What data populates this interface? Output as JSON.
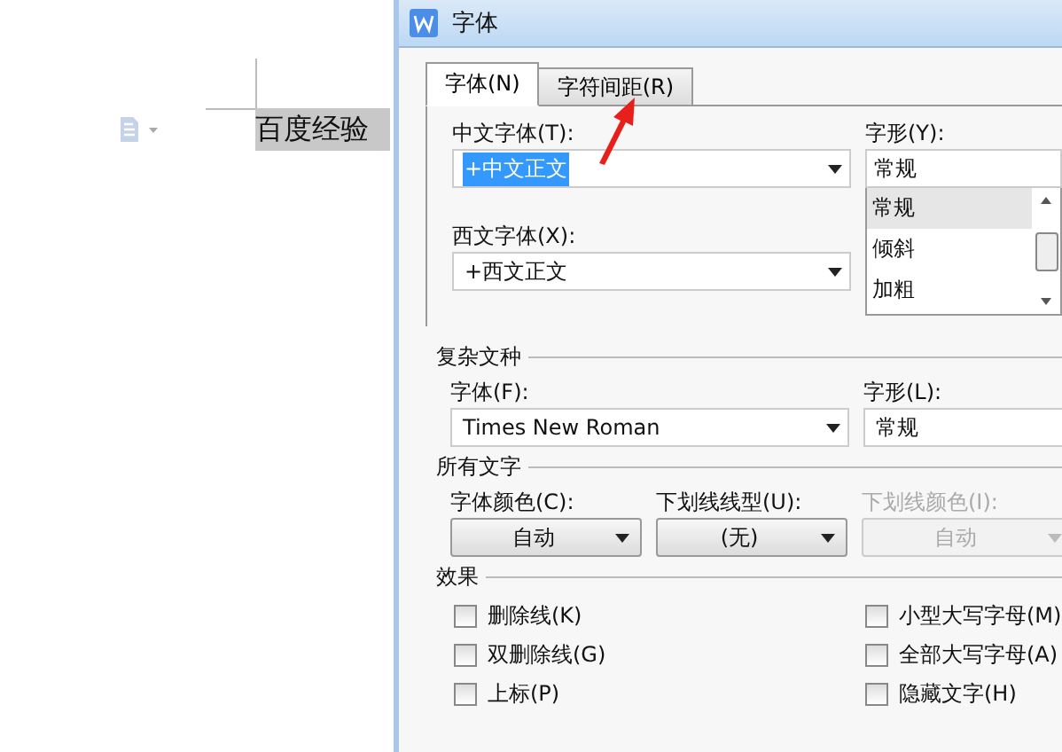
{
  "document": {
    "text": "百度经验",
    "highlighted": true
  },
  "dialog": {
    "title": "字体",
    "tabs": [
      {
        "label": "字体(N)",
        "selected": true
      },
      {
        "label": "字符间距(R)",
        "selected": false
      }
    ],
    "chinese_font": {
      "label": "中文字体(T):",
      "value": "+中文正文",
      "text_selected": true
    },
    "style": {
      "label": "字形(Y):",
      "value": "常规",
      "options": [
        {
          "label": "常规",
          "selected": true
        },
        {
          "label": "倾斜",
          "selected": false
        },
        {
          "label": "加粗",
          "selected": false
        }
      ]
    },
    "western_font": {
      "label": "西文字体(X):",
      "value": "+西文正文",
      "text_selected": false
    },
    "complex_script": {
      "heading": "复杂文种",
      "font": {
        "label": "字体(F):",
        "value": "Times New Roman"
      },
      "style": {
        "label": "字形(L):",
        "value": "常规"
      }
    },
    "all_text": {
      "heading": "所有文字",
      "controls": [
        {
          "label": "字体颜色(C):",
          "value": "自动",
          "disabled": false
        },
        {
          "label": "下划线线型(U):",
          "value": "(无)",
          "disabled": false
        },
        {
          "label": "下划线颜色(I):",
          "value": "自动",
          "disabled": true
        }
      ]
    },
    "effects": {
      "heading": "效果",
      "options": [
        {
          "label": "删除线(K)",
          "checked": false
        },
        {
          "label": "小型大写字母(M)",
          "checked": false
        },
        {
          "label": "双删除线(G)",
          "checked": false
        },
        {
          "label": "全部大写字母(A)",
          "checked": false
        },
        {
          "label": "上标(P)",
          "checked": false
        },
        {
          "label": "隐藏文字(H)",
          "checked": false
        }
      ]
    }
  }
}
